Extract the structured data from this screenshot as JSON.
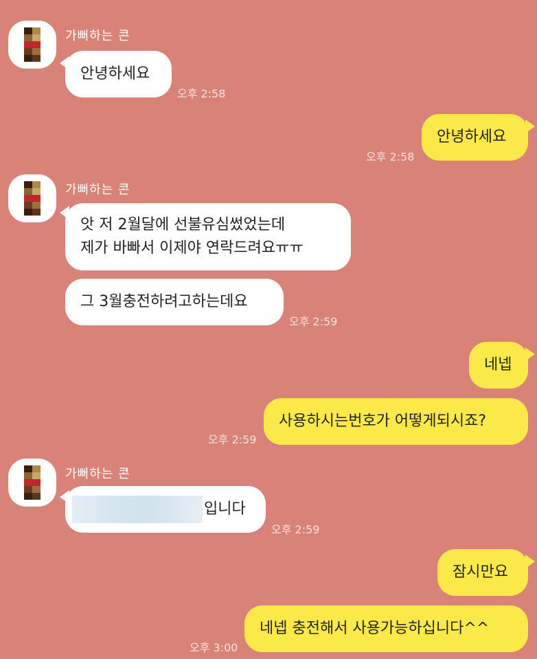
{
  "chat": {
    "sender_name": "가뻐하는 콘",
    "messages": [
      {
        "side": "left",
        "text": "안녕하세요",
        "time": "오후 2:58"
      },
      {
        "side": "right",
        "text": "안녕하세요",
        "time": "오후 2:58"
      },
      {
        "side": "left",
        "lines": [
          "앗 저 2월달에 선불유심썼었는데",
          "제가 바빠서 이제야 연락드려요ㅠㅠ"
        ]
      },
      {
        "side": "left",
        "text": "그 3월충전하려고하는데요",
        "time": "오후 2:59"
      },
      {
        "side": "right",
        "text": "네넵"
      },
      {
        "side": "right",
        "text": "사용하시는번호가 어떻게되시죠?",
        "time": "오후 2:59"
      },
      {
        "side": "left",
        "text": "입니다",
        "time": "오후 2:59"
      },
      {
        "side": "right",
        "text": "잠시만요"
      },
      {
        "side": "right",
        "text": "네넵 충전해서 사용가능하십니다^^",
        "time": "오후 3:00"
      }
    ]
  },
  "colors": {
    "background": "#d98278",
    "incoming_bubble": "#ffffff",
    "outgoing_bubble": "#fbe94a"
  }
}
